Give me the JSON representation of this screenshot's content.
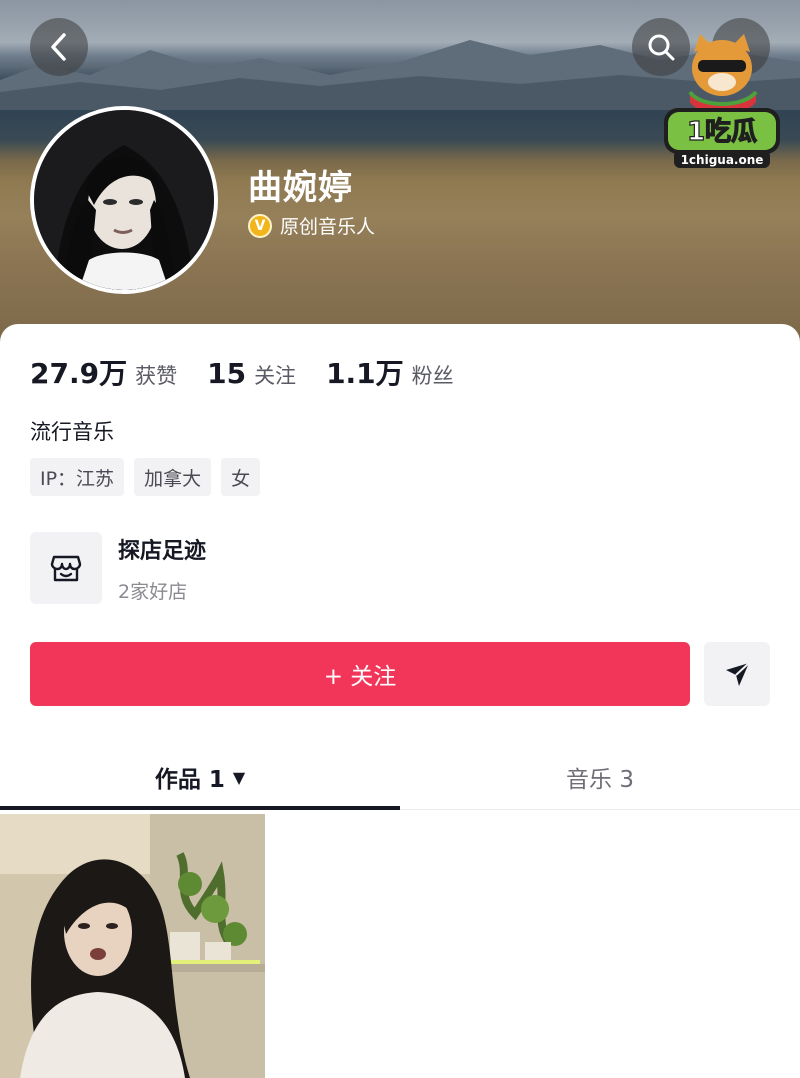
{
  "header": {
    "profile_name": "曲婉婷",
    "verify_badge": "V",
    "verify_text": "原创音乐人"
  },
  "watermark": {
    "brand": "1吃瓜",
    "domain": "1chigua.one"
  },
  "stats": [
    {
      "value": "27.9万",
      "label": "获赞"
    },
    {
      "value": "15",
      "label": "关注"
    },
    {
      "value": "1.1万",
      "label": "粉丝"
    }
  ],
  "bio": "流行音乐",
  "tags": [
    "IP：江苏",
    "加拿大",
    "女"
  ],
  "store": {
    "title": "探店足迹",
    "subtitle": "2家好店"
  },
  "actions": {
    "follow_label": "+ 关注"
  },
  "tabs": {
    "works_label": "作品 1",
    "works_arrow": "▼",
    "music_label": "音乐 3"
  },
  "colors": {
    "accent": "#f2365a",
    "badge": "#f2b51b"
  },
  "icons": [
    "back-arrow-icon",
    "search-icon",
    "more-icon",
    "store-icon",
    "share-icon"
  ]
}
